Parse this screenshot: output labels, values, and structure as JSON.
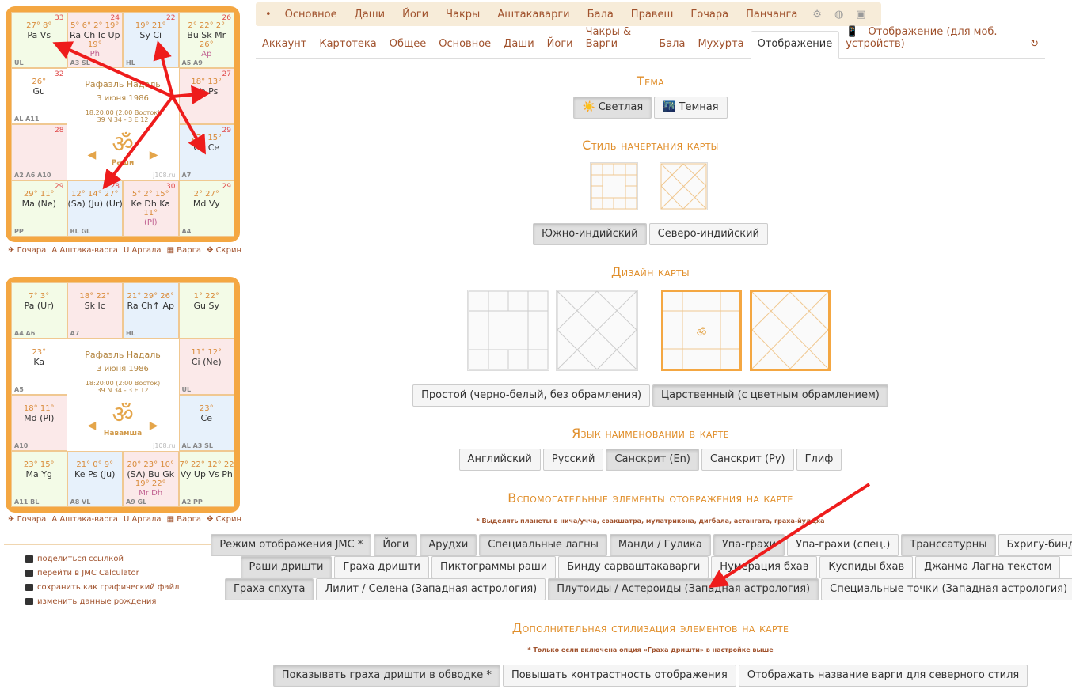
{
  "rasi_chart": {
    "name": "Рафаэль Надаль",
    "date": "3 июня 1986",
    "time": "18:20:00 (2:00 Восток)",
    "coords": "39 N 34 - 3 E 12",
    "om": "ॐ",
    "label": "Раши",
    "site": "j108.ru",
    "cells": [
      {
        "num": "33",
        "l1": "27° 8°",
        "l2": "Pa Vs",
        "l3": "",
        "corner": "UL"
      },
      {
        "num": "24",
        "l1": "5° 6° 2° 19°",
        "l2": "Ra Ch Ic Up",
        "l3": "19°",
        "l4": "Ph",
        "corner": "A3 SL"
      },
      {
        "num": "22",
        "l1": "19° 21°",
        "l2": "Sy Ci",
        "l3": "",
        "corner": "HL"
      },
      {
        "num": "26",
        "l1": "2° 22° 2°",
        "l2": "Bu Sk Mr",
        "l3": "26°",
        "l4": "Ap",
        "corner": "A5 A9"
      },
      {
        "num": "32",
        "l1": "26°",
        "l2": "Gu",
        "l3": "",
        "corner": "AL A11"
      },
      {
        "num": "27",
        "l1": "18° 13°",
        "l2": "Ve Ps",
        "l3": "",
        "corner": ""
      },
      {
        "num": "28",
        "l1": "",
        "l2": "",
        "l3": "",
        "corner": "A2 A6 A10"
      },
      {
        "num": "29",
        "l1": "27° 15°",
        "l2": "Gk Ce",
        "l3": "",
        "corner": "A7"
      },
      {
        "num": "29",
        "l1": "29° 11°",
        "l2": "Ma (Ne)",
        "l3": "",
        "corner": "PP"
      },
      {
        "num": "28",
        "l1": "12° 14° 27°",
        "l2": "(Sa) (Ju) (Ur)",
        "l3": "",
        "corner": "BL GL"
      },
      {
        "num": "30",
        "l1": "5° 2° 15°",
        "l2": "Ke Dh Ka",
        "l3": "11°",
        "l4": "(Pl)",
        "corner": ""
      },
      {
        "num": "29",
        "l1": "2° 27°",
        "l2": "Md Vy",
        "l3": "",
        "corner": "A4"
      }
    ]
  },
  "navamsa_chart": {
    "name": "Рафаэль Надаль",
    "date": "3 июня 1986",
    "time": "18:20:00 (2:00 Восток)",
    "coords": "39 N 34 - 3 E 12",
    "om": "ॐ",
    "label": "Навамша",
    "site": "j108.ru",
    "cells": [
      {
        "num": "",
        "l1": "7° 3°",
        "l2": "Pa (Ur)",
        "l3": "",
        "corner": "A4 A6"
      },
      {
        "num": "",
        "l1": "18° 22°",
        "l2": "Sk Ic",
        "l3": "",
        "corner": "A7"
      },
      {
        "num": "",
        "l1": "21° 29° 26°",
        "l2": "Ra Ch↑ Ap",
        "l3": "",
        "corner": "HL"
      },
      {
        "num": "",
        "l1": "1° 22°",
        "l2": "Gu Sy",
        "l3": "",
        "corner": ""
      },
      {
        "num": "",
        "l1": "23°",
        "l2": "Ka",
        "l3": "",
        "corner": "A5"
      },
      {
        "num": "",
        "l1": "11° 12°",
        "l2": "Ci (Ne)",
        "l3": "",
        "corner": "UL"
      },
      {
        "num": "",
        "l1": "18° 11°",
        "l2": "Md (Pl)",
        "l3": "",
        "corner": "A10"
      },
      {
        "num": "",
        "l1": "23°",
        "l2": "Ce",
        "l3": "",
        "corner": "AL A3 SL"
      },
      {
        "num": "",
        "l1": "23° 15°",
        "l2": "Ma Yg",
        "l3": "",
        "corner": "A11 BL"
      },
      {
        "num": "",
        "l1": "21° 0° 9°",
        "l2": "Ke Ps (Ju)",
        "l3": "",
        "corner": "A8 VL"
      },
      {
        "num": "",
        "l1": "20° 23° 10°",
        "l2": "(SA) Bu Gk",
        "l3": "19° 22°",
        "l4": "Mr Dh",
        "corner": "A9 GL"
      },
      {
        "num": "",
        "l1": "7° 22° 12° 22°",
        "l2": "Vy Up Vs Ph",
        "l3": "",
        "corner": "A2 PP"
      }
    ]
  },
  "chart_toolbar": {
    "gochara": "Гочара",
    "ashtaka": "Аштака-варга",
    "argala": "Аргала",
    "varga": "Варга",
    "screen": "Скрин"
  },
  "side_links": [
    "поделиться ссылкой",
    "перейти в JMC Calculator",
    "сохранить как графический файл",
    "изменить данные рождения"
  ],
  "top_tabs": [
    "•",
    "Основное",
    "Даши",
    "Йоги",
    "Чакры",
    "Аштакаварги",
    "Бала",
    "Правеш",
    "Гочара",
    "Панчанга",
    "⚙",
    "◍",
    "▣"
  ],
  "sub_tabs": [
    "Аккаунт",
    "Картотека",
    "Общее",
    "Основное",
    "Даши",
    "Йоги",
    "Чакры & Варги",
    "Бала",
    "Мухурта",
    "Отображение",
    "Отображение (для моб. устройств)",
    "↻"
  ],
  "sections": {
    "theme": {
      "title": "Тема",
      "buttons": [
        "☀️ Светлая",
        "🌃 Темная"
      ]
    },
    "style": {
      "title": "Стиль начертания карты",
      "buttons": [
        "Южно-индийский",
        "Северо-индийский"
      ]
    },
    "design": {
      "title": "Дизайн карты",
      "buttons": [
        "Простой (черно-белый, без обрамления)",
        "Царственный (с цветным обрамлением)"
      ]
    },
    "lang": {
      "title": "Язык наименований в карте",
      "buttons": [
        "Английский",
        "Русский",
        "Санскрит (En)",
        "Санскрит (Ру)",
        "Глиф"
      ]
    },
    "aux": {
      "title": "Вспомогательные элементы отображения на карте",
      "note": "* Выделять планеты в нича/учча, свакшатра, мулатрикона, дигбала, астангата, граха-йуддха",
      "row1": [
        "Режим отображения JMC *",
        "Йоги",
        "Арудхи",
        "Специальные лагны",
        "Манди / Гулика",
        "Упа-грахи",
        "Упа-грахи (спец.)",
        "Транссатурны",
        "Бхригу-бинду"
      ],
      "row2": [
        "Раши дришти",
        "Граха дришти",
        "Пиктограммы раши",
        "Бинду сарваштакаварги",
        "Нумерация бхав",
        "Куспиды бхав",
        "Джанма Лагна текстом"
      ],
      "row3": [
        "Граха спхута",
        "Лилит / Селена (Западная астрология)",
        "Плутоиды / Астероиды (Западная астрология)",
        "Специальные точки (Западная астрология)"
      ]
    },
    "extra": {
      "title": "Дополнительная стилизация элементов на карте",
      "note": "* Только если включена опция «Граха дришти» в настройке выше",
      "buttons": [
        "Показывать граха дришти в обводке *",
        "Повышать контрастность отображения",
        "Отображать название варги для северного стиля"
      ]
    }
  },
  "colors": {
    "accent": "#e08e2a",
    "link": "#a0522d",
    "arrow": "#ee1c1c",
    "frame": "#f4a742"
  }
}
